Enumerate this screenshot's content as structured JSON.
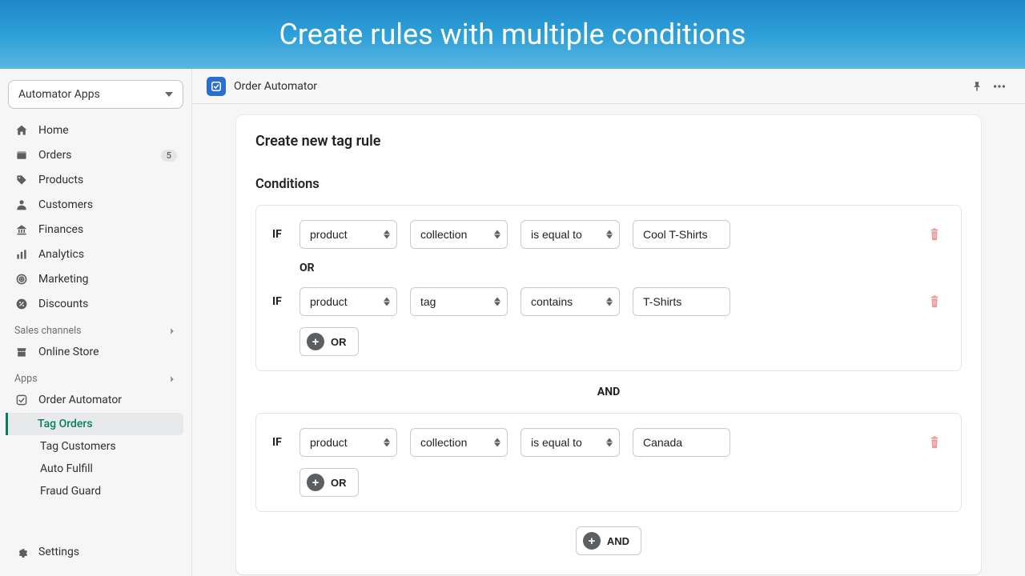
{
  "banner": {
    "title": "Create rules with multiple conditions"
  },
  "sidebar": {
    "app_selector": "Automator Apps",
    "nav": [
      {
        "label": "Home",
        "icon": "home-icon"
      },
      {
        "label": "Orders",
        "icon": "orders-icon",
        "badge": "5"
      },
      {
        "label": "Products",
        "icon": "products-icon"
      },
      {
        "label": "Customers",
        "icon": "customers-icon"
      },
      {
        "label": "Finances",
        "icon": "finances-icon"
      },
      {
        "label": "Analytics",
        "icon": "analytics-icon"
      },
      {
        "label": "Marketing",
        "icon": "marketing-icon"
      },
      {
        "label": "Discounts",
        "icon": "discounts-icon"
      }
    ],
    "sales_channels_label": "Sales channels",
    "online_store": "Online Store",
    "apps_label": "Apps",
    "app_name": "Order Automator",
    "subnav": [
      {
        "label": "Tag Orders",
        "active": true
      },
      {
        "label": "Tag Customers"
      },
      {
        "label": "Auto Fulfill"
      },
      {
        "label": "Fraud Guard"
      }
    ],
    "settings": "Settings"
  },
  "topbar": {
    "app_name": "Order Automator"
  },
  "form": {
    "title": "Create new tag rule",
    "conditions_label": "Conditions",
    "if_label": "IF",
    "or_label": "OR",
    "and_label": "AND",
    "groups": [
      {
        "rows": [
          {
            "field": "product",
            "attr": "collection",
            "op": "is equal to",
            "value": "Cool T-Shirts"
          },
          {
            "field": "product",
            "attr": "tag",
            "op": "contains",
            "value": "T-Shirts"
          }
        ]
      },
      {
        "rows": [
          {
            "field": "product",
            "attr": "collection",
            "op": "is equal to",
            "value": "Canada"
          }
        ]
      }
    ],
    "add_or_label": "OR",
    "add_and_label": "AND"
  }
}
